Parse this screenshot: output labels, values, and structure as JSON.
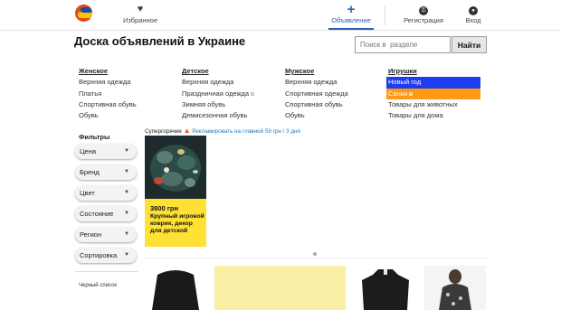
{
  "nav": {
    "favorites": "Избранное",
    "post_ad": "Объявление",
    "register": "Регистрация",
    "login": "Вход"
  },
  "page_title": "Доска объявлений в Украине",
  "search": {
    "placeholder": "Поиск в  разделе",
    "button": "Найти"
  },
  "categories": [
    {
      "title": "Женское",
      "items": [
        "Верхняя одежда",
        "Платья",
        "Спортивная обувь",
        "Обувь"
      ]
    },
    {
      "title": "Детское",
      "items": [
        "Верхняя одежда",
        "Праздничная одежда",
        "Зимняя обувь",
        "Демисезонная обувь"
      ]
    },
    {
      "title": "Мужское",
      "items": [
        "Верхняя одежда",
        "Спортивная одежда",
        "Спортивная обувь",
        "Обувь"
      ]
    },
    {
      "title": "Игрушки",
      "items": [
        "Новый год",
        "Санки",
        "Товары для животных",
        "Товары для дома"
      ]
    }
  ],
  "filters": {
    "title": "Фильтры",
    "items": [
      "Цена",
      "Бренд",
      "Цвет",
      "Состояние",
      "Регион",
      "Сортировка"
    ],
    "blacklist": "Черный список"
  },
  "super_hot": {
    "label": "Супергорячие",
    "promo": "Рекламировать на главной 59 грн / 3 дня",
    "card": {
      "price": "3800 грн",
      "title": "Крупный игровой коврик, декор для детской"
    }
  },
  "colors": {
    "accent_blue": "#2a62b8",
    "highlight_blue": "#1e3df0",
    "highlight_orange": "#ff9a14",
    "card_yellow": "#ffe135"
  }
}
